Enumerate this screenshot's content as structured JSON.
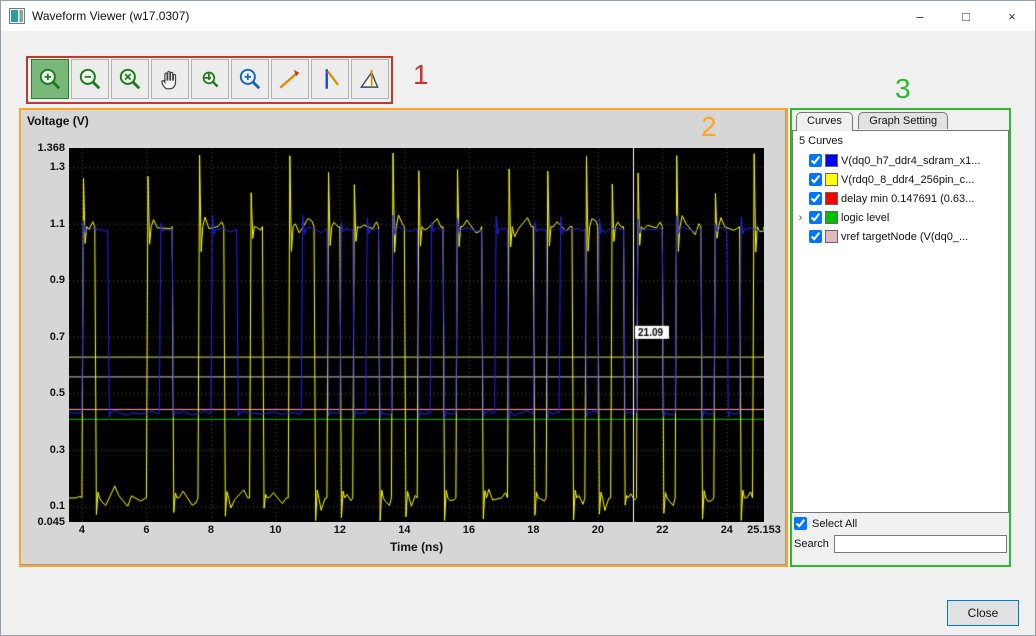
{
  "window": {
    "title": "Waveform Viewer (w17.0307)",
    "controls": {
      "minimize": "–",
      "maximize": "□",
      "close": "×"
    }
  },
  "toolbar": {
    "buttons": [
      {
        "name": "zoom-in",
        "icon": "magnifier-plus",
        "active": true
      },
      {
        "name": "zoom-out",
        "icon": "magnifier-minus",
        "active": false
      },
      {
        "name": "zoom-x",
        "icon": "magnifier-x",
        "active": false
      },
      {
        "name": "pan",
        "icon": "hand",
        "active": false
      },
      {
        "name": "zoom-area",
        "icon": "magnifier-small",
        "active": false
      },
      {
        "name": "zoom-fit",
        "icon": "magnifier-blue",
        "active": false
      },
      {
        "name": "slope-marker",
        "icon": "slope",
        "active": false
      },
      {
        "name": "vertical-marker",
        "icon": "vertical-marker",
        "active": false
      },
      {
        "name": "measurement",
        "icon": "ruler-triangle",
        "active": false
      }
    ],
    "active_color": "#79b879"
  },
  "plot": {
    "ylabel": "Voltage (V)",
    "xlabel": "Time (ns)"
  },
  "chart_data": {
    "type": "line",
    "title": "",
    "xlabel": "Time (ns)",
    "ylabel": "Voltage (V)",
    "x_range": [
      3.597,
      25.153
    ],
    "y_range": [
      0.045,
      1.368
    ],
    "x_ticks": [
      4,
      6,
      8,
      10,
      12,
      14,
      16,
      18,
      20,
      22,
      24,
      25.153
    ],
    "y_ticks": [
      0.045,
      0.1,
      0.3,
      0.5,
      0.7,
      0.9,
      1.1,
      1.3,
      1.368
    ],
    "grid": true,
    "background": "#000000",
    "cursor": {
      "x": 21.09,
      "label": "21.09",
      "color": "#ffffff"
    },
    "ref_lines": [
      {
        "name": "delay-min-level",
        "value": 0.63,
        "color": "#d8d870"
      },
      {
        "name": "mid-level",
        "value": 0.56,
        "color": "#c9c9c9"
      },
      {
        "name": "vref-targetNode",
        "value": 0.445,
        "color": "#ff9db0"
      },
      {
        "name": "logic-level",
        "value": 0.41,
        "color": "#00c000"
      }
    ],
    "series": [
      {
        "name": "V(rdq0_8_ddr4_256pin_c...",
        "color": "#ffff00",
        "low": 0.13,
        "high": 1.09,
        "overshoot": 0.26,
        "undershoot": 0.08,
        "noise": 0.045,
        "t0": 3.597,
        "ui": 0.4,
        "bits": [
          0,
          1,
          0,
          0,
          0,
          0,
          1,
          1,
          0,
          0,
          1,
          1,
          0,
          0,
          1,
          0,
          0,
          1,
          1,
          0,
          1,
          0,
          1,
          1,
          0,
          1,
          0,
          1,
          1,
          0,
          1,
          1,
          0,
          0,
          1,
          1,
          0,
          1,
          1,
          0,
          1,
          0,
          1,
          0,
          1,
          1,
          0,
          1,
          1,
          0,
          1,
          1,
          0,
          1
        ]
      },
      {
        "name": "V(dq0_h7_ddr4_sdram_x1...",
        "color": "#2323ff",
        "low": 0.43,
        "high": 1.08,
        "overshoot": 0.05,
        "undershoot": 0.02,
        "noise": 0.012,
        "t0": 3.597,
        "ui": 0.4,
        "bits": [
          0,
          1,
          1,
          0,
          0,
          0,
          0,
          1,
          0,
          0,
          0,
          1,
          1,
          0,
          0,
          0,
          0,
          0,
          1,
          1,
          0,
          1,
          0,
          1,
          0,
          1,
          1,
          0,
          1,
          0,
          1,
          1,
          0,
          1,
          0,
          0,
          1,
          0,
          1,
          1,
          0,
          1,
          1,
          0,
          1,
          1,
          0,
          1,
          1,
          0,
          1,
          0,
          1,
          1
        ]
      }
    ]
  },
  "curves_panel": {
    "tabs": [
      "Curves",
      "Graph Setting"
    ],
    "active_tab": "Curves",
    "count_label": "5 Curves",
    "curves": [
      {
        "color": "#0000ff",
        "label": "V(dq0_h7_ddr4_sdram_x1...",
        "checked": true,
        "expandable": false
      },
      {
        "color": "#ffff00",
        "label": "V(rdq0_8_ddr4_256pin_c...",
        "checked": true,
        "expandable": false
      },
      {
        "color": "#ff0000",
        "label": "delay min 0.147691 (0.63...",
        "checked": true,
        "expandable": false
      },
      {
        "color": "#00c000",
        "label": "logic level",
        "checked": true,
        "expandable": true
      },
      {
        "color": "#e3b8bc",
        "label": "vref targetNode (V(dq0_...",
        "checked": true,
        "expandable": false
      }
    ],
    "select_all_label": "Select All",
    "select_all_checked": true,
    "search_label": "Search",
    "search_value": ""
  },
  "footer": {
    "close_label": "Close"
  },
  "annotations": [
    {
      "label": "1",
      "color": "#c0392b"
    },
    {
      "label": "2",
      "color": "#ffa51f"
    },
    {
      "label": "3",
      "color": "#2db82d"
    }
  ]
}
